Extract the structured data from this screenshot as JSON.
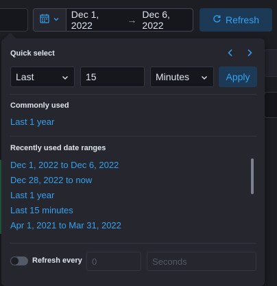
{
  "header": {
    "start_date": "Dec 1, 2022",
    "arrow": "→",
    "end_date": "Dec 6, 2022",
    "refresh_label": "Refresh"
  },
  "quick_select": {
    "title": "Quick select",
    "direction": "Last",
    "amount": "15",
    "unit": "Minutes",
    "apply_label": "Apply"
  },
  "commonly_used": {
    "title": "Commonly used",
    "items": [
      "Last 1 year"
    ]
  },
  "recent": {
    "title": "Recently used date ranges",
    "items": [
      "Dec 1, 2022 to Dec 6, 2022",
      "Dec 28, 2022 to now",
      "Last 1 year",
      "Last 15 minutes",
      "Apr 1, 2021 to Mar 31, 2022"
    ]
  },
  "refresh_every": {
    "label": "Refresh every",
    "interval_placeholder": "0",
    "unit_placeholder": "Seconds"
  },
  "colors": {
    "accent": "#36a2ef",
    "panel": "#25262e",
    "background": "#1d1e24"
  }
}
